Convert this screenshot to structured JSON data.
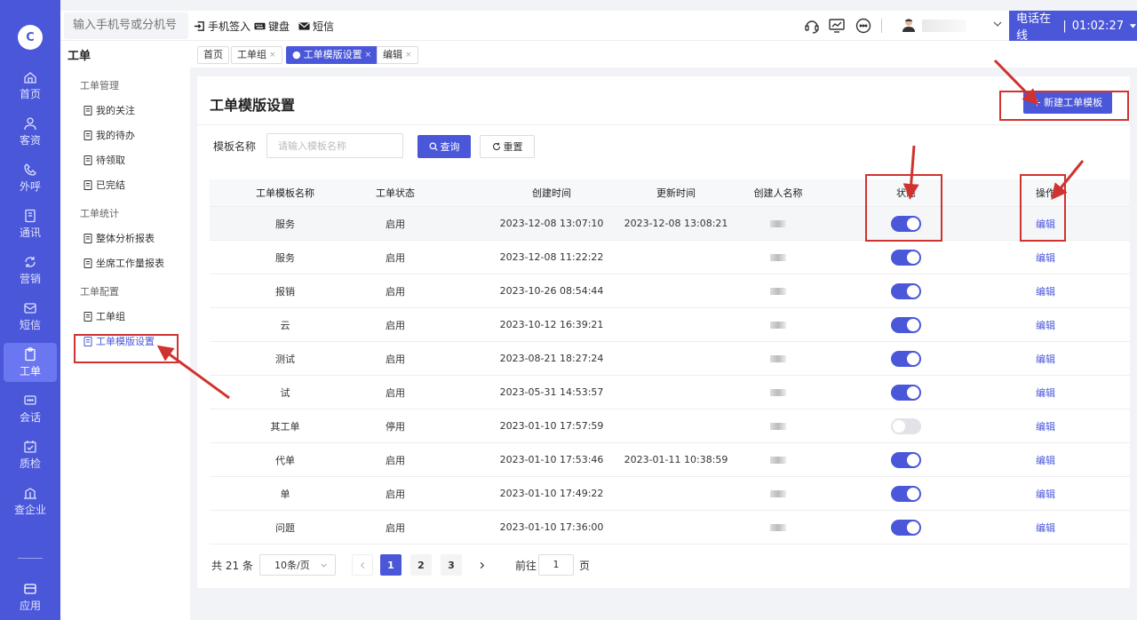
{
  "rail": {
    "items": [
      {
        "label": "首页",
        "icon": "home-icon"
      },
      {
        "label": "客资",
        "icon": "customer-icon"
      },
      {
        "label": "外呼",
        "icon": "outbound-call-icon"
      },
      {
        "label": "通讯",
        "icon": "contacts-icon"
      },
      {
        "label": "营销",
        "icon": "marketing-icon"
      },
      {
        "label": "短信",
        "icon": "sms-icon"
      },
      {
        "label": "工单",
        "icon": "ticket-icon",
        "active": true
      },
      {
        "label": "会话",
        "icon": "chat-icon"
      },
      {
        "label": "质检",
        "icon": "quality-check-icon"
      },
      {
        "label": "查企业",
        "icon": "company-icon"
      }
    ],
    "app_label": "应用"
  },
  "topbar": {
    "phone_placeholder": "输入手机号或分机号",
    "checkin": "手机签入",
    "keyboard": "键盘",
    "sms": "短信",
    "online_status": "电话在线",
    "separator": "|",
    "timer": "01:02:27"
  },
  "sidebar": {
    "title": "工单",
    "groups": [
      {
        "label": "工单管理",
        "items": [
          "我的关注",
          "我的待办",
          "待领取",
          "已完结"
        ]
      },
      {
        "label": "工单统计",
        "items": [
          "整体分析报表",
          "坐席工作量报表"
        ]
      },
      {
        "label": "工单配置",
        "items": [
          "工单组",
          "工单模版设置"
        ]
      }
    ],
    "active_item": "工单模版设置"
  },
  "tabs": [
    {
      "label": "首页",
      "closable": false
    },
    {
      "label": "工单组",
      "closable": true
    },
    {
      "label": "工单模版设置",
      "closable": true,
      "active": true
    },
    {
      "label": "编辑",
      "closable": true
    }
  ],
  "tab_active_dot": "●",
  "tab_close": "×",
  "page": {
    "title": "工单模版设置",
    "new_button": "新建工单模板",
    "filter_label": "模板名称",
    "filter_placeholder": "请输入模板名称",
    "query_button": "查询",
    "reset_button": "重置"
  },
  "table": {
    "headers": [
      "工单模板名称",
      "工单状态",
      "创建时间",
      "更新时间",
      "创建人名称",
      "状态",
      "操作"
    ],
    "rows": [
      {
        "name": "服务",
        "status": "启用",
        "created": "2023-12-08 13:07:10",
        "updated": "2023-12-08 13:08:21",
        "enabled": true,
        "action": "编辑"
      },
      {
        "name": "服务",
        "status": "启用",
        "created": "2023-12-08 11:22:22",
        "updated": "",
        "enabled": true,
        "action": "编辑"
      },
      {
        "name": "报销",
        "status": "启用",
        "created": "2023-10-26 08:54:44",
        "updated": "",
        "enabled": true,
        "action": "编辑"
      },
      {
        "name": "云",
        "status": "启用",
        "created": "2023-10-12 16:39:21",
        "updated": "",
        "enabled": true,
        "action": "编辑"
      },
      {
        "name": "测试",
        "status": "启用",
        "created": "2023-08-21 18:27:24",
        "updated": "",
        "enabled": true,
        "action": "编辑"
      },
      {
        "name": "试",
        "status": "启用",
        "created": "2023-05-31 14:53:57",
        "updated": "",
        "enabled": true,
        "action": "编辑"
      },
      {
        "name": "其工单",
        "status": "停用",
        "created": "2023-01-10 17:57:59",
        "updated": "",
        "enabled": false,
        "action": "编辑"
      },
      {
        "name": "代单",
        "status": "启用",
        "created": "2023-01-10 17:53:46",
        "updated": "2023-01-11 10:38:59",
        "enabled": true,
        "action": "编辑"
      },
      {
        "name": "单",
        "status": "启用",
        "created": "2023-01-10 17:49:22",
        "updated": "",
        "enabled": true,
        "action": "编辑"
      },
      {
        "name": "问题",
        "status": "启用",
        "created": "2023-01-10 17:36:00",
        "updated": "",
        "enabled": true,
        "action": "编辑"
      }
    ]
  },
  "pager": {
    "total": "共 21 条",
    "page_size": "10条/页",
    "pages": [
      "1",
      "2",
      "3"
    ],
    "current": "1",
    "goto_label": "前往",
    "goto_value": "1",
    "goto_suffix": "页"
  },
  "colors": {
    "accent": "#4a57d9",
    "annotation_red": "#d0332f"
  }
}
